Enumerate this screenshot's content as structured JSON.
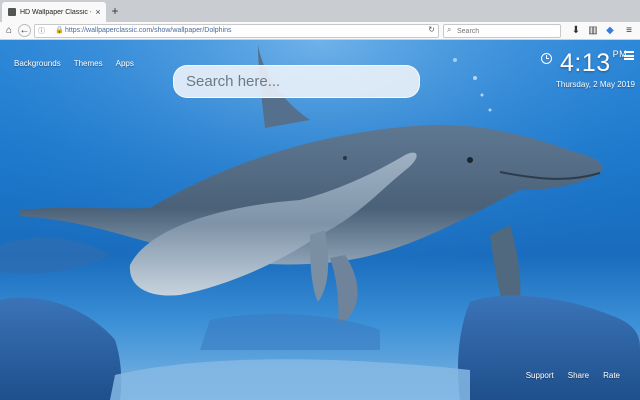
{
  "browser": {
    "tab_title": "HD Wallpaper Classic - Dolphins",
    "url": "https://wallpaperclassic.com/show/wallpaper/Dolphins",
    "search_placeholder": "Search"
  },
  "newtab": {
    "links": [
      "Backgrounds",
      "Themes",
      "Apps"
    ],
    "search_placeholder": "Search here...",
    "time": "4:13",
    "time_suffix": "PM",
    "date": "Thursday, 2 May 2019",
    "footer_links": [
      "Support",
      "Share",
      "Rate"
    ]
  },
  "wallpaper": {
    "subject": "dolphins-underwater"
  },
  "colors": {
    "water": "#1c78cc",
    "accent_white": "#ffffff"
  }
}
